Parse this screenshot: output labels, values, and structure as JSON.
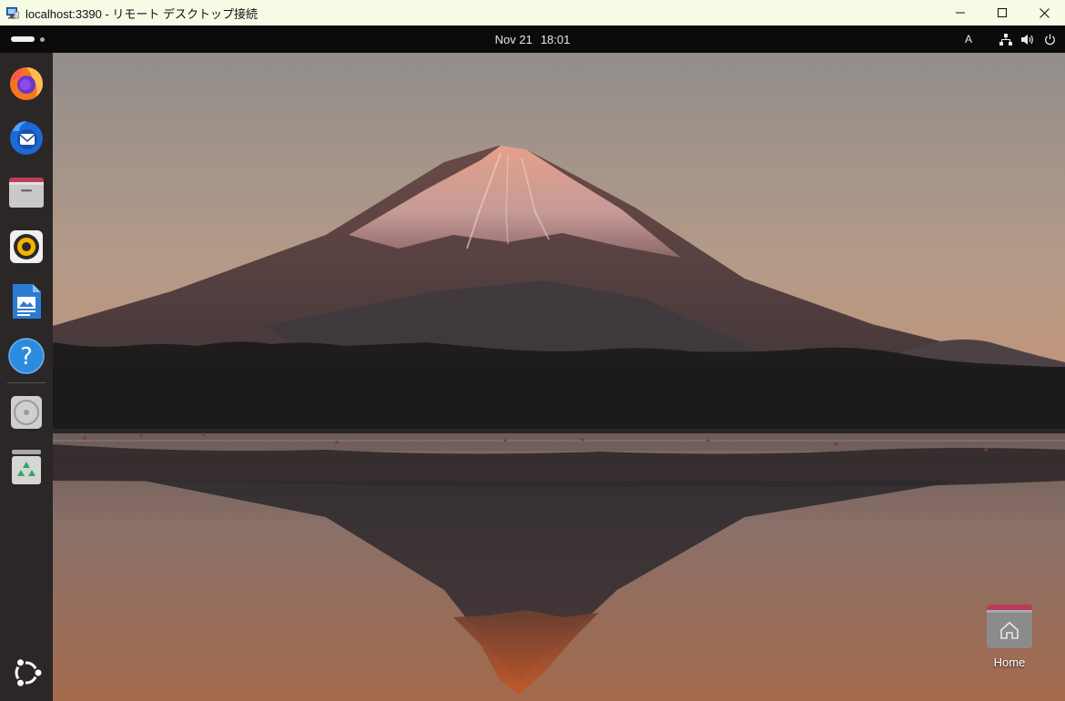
{
  "window": {
    "title": "localhost:3390 - リモート デスクトップ接続"
  },
  "topbar": {
    "date": "Nov 21",
    "time": "18:01",
    "input_method": "A"
  },
  "desktop": {
    "icons": [
      {
        "label": "Home",
        "icon": "home-folder-icon"
      }
    ]
  },
  "dock": {
    "apps": [
      "firefox-icon",
      "thunderbird-icon",
      "files-icon",
      "rhythmbox-icon",
      "libreoffice-writer-icon",
      "help-icon"
    ],
    "devices": [
      "optical-drive-icon",
      "trash-icon"
    ],
    "app_grid": "ubuntu-apps-icon"
  },
  "colors": {
    "titlebar_bg": "#f6fbe6",
    "topbar_bg": "#0b0b0b",
    "dock_bg": "#2b2727",
    "accent": "#e95420"
  }
}
